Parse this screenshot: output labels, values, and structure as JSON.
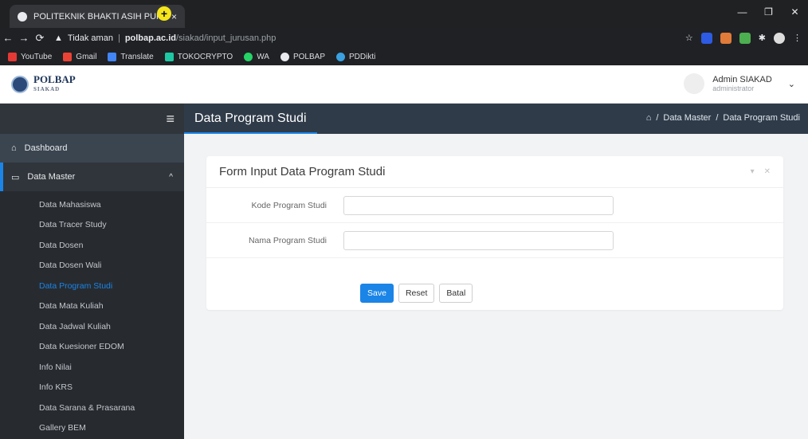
{
  "browser": {
    "tab_title": "POLITEKNIK BHAKTI ASIH PURW",
    "tab_close": "×",
    "new_tab": "+",
    "address": {
      "warning": "Tidak aman",
      "host": "polbap.ac.id",
      "path": "/siakad/input_jurusan.php"
    },
    "bookmarks": [
      "YouTube",
      "Gmail",
      "Translate",
      "TOKOCRYPTO",
      "WA",
      "POLBAP",
      "PDDikti"
    ]
  },
  "header": {
    "logo_text": "POLBAP",
    "logo_sub": "SIAKAD",
    "user_name": "Admin SIAKAD",
    "user_role": "administrator"
  },
  "sidebar": {
    "toggle": "≡",
    "dashboard": "Dashboard",
    "data_master": "Data Master",
    "sub_items": [
      "Data Mahasiswa",
      "Data Tracer Study",
      "Data Dosen",
      "Data Dosen Wali",
      "Data Program Studi",
      "Data Mata Kuliah",
      "Data Jadwal Kuliah",
      "Data Kuesioner EDOM",
      "Info Nilai",
      "Info KRS",
      "Data Sarana & Prasarana",
      "Gallery BEM"
    ],
    "active_sub": "Data Program Studi"
  },
  "content": {
    "title": "Data Program Studi",
    "breadcrumb": [
      "Data Master",
      "Data Program Studi"
    ],
    "form_title": "Form Input Data Program Studi",
    "fields": [
      {
        "label": "Kode Program Studi",
        "value": ""
      },
      {
        "label": "Nama Program Studi",
        "value": ""
      }
    ],
    "buttons": {
      "save": "Save",
      "reset": "Reset",
      "cancel": "Batal"
    }
  },
  "colors": {
    "accent": "#1b84e7",
    "sidebar_bg": "#272b30",
    "content_header_bg": "#2f3b49"
  }
}
